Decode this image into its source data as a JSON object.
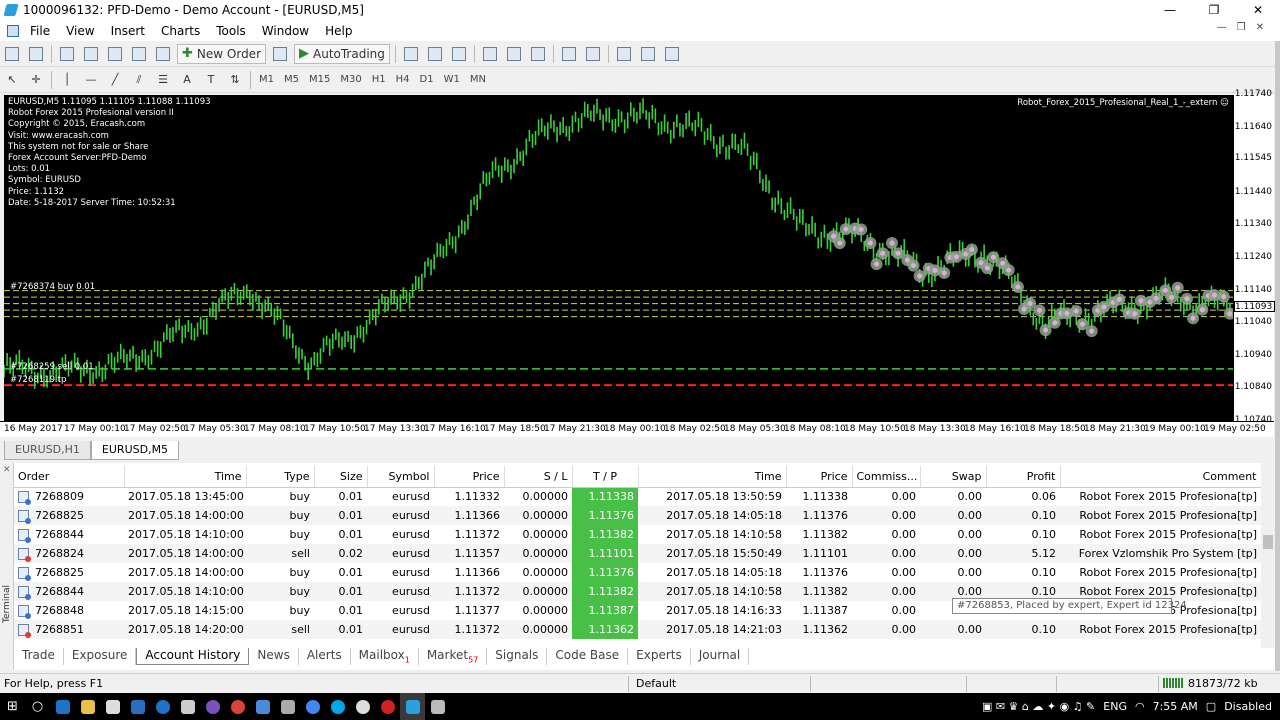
{
  "window": {
    "title": "1000096132: PFD-Demo - Demo Account - [EURUSD,M5]",
    "controls": [
      "—",
      "❐",
      "✕"
    ]
  },
  "menu": [
    "File",
    "View",
    "Insert",
    "Charts",
    "Tools",
    "Window",
    "Help"
  ],
  "toolbar": {
    "new_order": "New Order",
    "auto_trading": "AutoTrading"
  },
  "timeframes": [
    "M1",
    "M5",
    "M15",
    "M30",
    "H1",
    "H4",
    "D1",
    "W1",
    "MN"
  ],
  "chart": {
    "symbol_line": "EURUSD,M5  1.11095 1.11105 1.11088 1.11093",
    "ea_name": "Robot_Forex_2015_Profesional_Real_1_-_extern",
    "info_lines": [
      "Robot Forex 2015 Profesional version II",
      "Copyright © 2015, Eracash.com",
      "Visit: www.eracash.com",
      "This system not for sale or Share",
      "Forex Account Server:PFD-Demo",
      "Lots:  0.01",
      "Symbol: EURUSD",
      "Price:  1.1132",
      "Date: 5-18-2017 Server Time: 10:52:31"
    ],
    "order_labels": [
      "#7268374 buy 0.01",
      "#7268259 sell 0.01",
      "#7268119 tp"
    ],
    "price_labels": [
      "1.11740",
      "1.11640",
      "1.11545",
      "1.11440",
      "1.11340",
      "1.11240",
      "1.11140",
      "1.11040",
      "1.10940",
      "1.10840",
      "1.10740"
    ],
    "current_price": "1.11093",
    "time_labels": [
      "16 May 2017",
      "17 May 00:10",
      "17 May 02:50",
      "17 May 05:30",
      "17 May 08:10",
      "17 May 10:50",
      "17 May 13:30",
      "17 May 16:10",
      "17 May 18:50",
      "17 May 21:30",
      "18 May 00:10",
      "18 May 02:50",
      "18 May 05:30",
      "18 May 08:10",
      "18 May 10:50",
      "18 May 13:30",
      "18 May 16:10",
      "18 May 18:50",
      "18 May 21:30",
      "19 May 00:10",
      "19 May 02:50"
    ],
    "tabs": [
      "EURUSD,H1",
      "EURUSD,M5"
    ],
    "colors": {
      "candle": "#3ccf3c",
      "marker": "#e7a6e0",
      "sl_line": "#ff2020"
    }
  },
  "chart_data": {
    "type": "line",
    "title": "",
    "xlabel": "",
    "ylabel": "",
    "ylim": [
      1.1074,
      1.1174
    ],
    "x": [
      "16 May 2017",
      "17 May 00:10",
      "17 May 02:50",
      "17 May 05:30",
      "17 May 08:10",
      "17 May 10:50",
      "17 May 13:30",
      "17 May 16:10",
      "17 May 18:50",
      "17 May 21:30",
      "18 May 00:10",
      "18 May 02:50",
      "18 May 05:30",
      "18 May 08:10",
      "18 May 10:50",
      "18 May 13:30",
      "18 May 16:10",
      "18 May 18:50",
      "18 May 21:30",
      "19 May 00:10",
      "19 May 02:50"
    ],
    "series": [
      {
        "name": "EURUSD,M5",
        "values": [
          1.109,
          1.1089,
          1.1092,
          1.1102,
          1.1115,
          1.1092,
          1.1105,
          1.1121,
          1.115,
          1.1165,
          1.1168,
          1.1165,
          1.1158,
          1.1133,
          1.113,
          1.112,
          1.1126,
          1.1104,
          1.1108,
          1.1112,
          1.1109
        ]
      }
    ],
    "grid": false,
    "legend": "none"
  },
  "terminal": {
    "side_label": "Terminal",
    "columns": [
      "Order",
      "Time",
      "Type",
      "Size",
      "Symbol",
      "Price",
      "S / L",
      "T / P",
      "Time",
      "Price",
      "Commiss...",
      "Swap",
      "Profit",
      "Comment"
    ],
    "rows": [
      [
        "7268809",
        "2017.05.18 13:45:00",
        "buy",
        "0.01",
        "eurusd",
        "1.11332",
        "0.00000",
        "1.11338",
        "2017.05.18 13:50:59",
        "1.11338",
        "0.00",
        "0.00",
        "0.06",
        "Robot Forex 2015 Profesiona[tp]"
      ],
      [
        "7268825",
        "2017.05.18 14:00:00",
        "buy",
        "0.01",
        "eurusd",
        "1.11366",
        "0.00000",
        "1.11376",
        "2017.05.18 14:05:18",
        "1.11376",
        "0.00",
        "0.00",
        "0.10",
        "Robot Forex 2015 Profesiona[tp]"
      ],
      [
        "7268844",
        "2017.05.18 14:10:00",
        "buy",
        "0.01",
        "eurusd",
        "1.11372",
        "0.00000",
        "1.11382",
        "2017.05.18 14:10:58",
        "1.11382",
        "0.00",
        "0.00",
        "0.10",
        "Robot Forex 2015 Profesiona[tp]"
      ],
      [
        "7268824",
        "2017.05.18 14:00:00",
        "sell",
        "0.02",
        "eurusd",
        "1.11357",
        "0.00000",
        "1.11101",
        "2017.05.18 15:50:49",
        "1.11101",
        "0.00",
        "0.00",
        "5.12",
        "Forex Vzlomshik Pro System [tp]"
      ],
      [
        "7268825",
        "2017.05.18 14:00:00",
        "buy",
        "0.01",
        "eurusd",
        "1.11366",
        "0.00000",
        "1.11376",
        "2017.05.18 14:05:18",
        "1.11376",
        "0.00",
        "0.00",
        "0.10",
        "Robot Forex 2015 Profesiona[tp]"
      ],
      [
        "7268844",
        "2017.05.18 14:10:00",
        "buy",
        "0.01",
        "eurusd",
        "1.11372",
        "0.00000",
        "1.11382",
        "2017.05.18 14:10:58",
        "1.11382",
        "0.00",
        "0.00",
        "0.10",
        "Robot Forex 2015 Profesiona[tp]"
      ],
      [
        "7268848",
        "2017.05.18 14:15:00",
        "buy",
        "0.01",
        "eurusd",
        "1.11377",
        "0.00000",
        "1.11387",
        "2017.05.18 14:16:33",
        "1.11387",
        "0.00",
        "0.00",
        "0.10",
        "Robot Forex 2015 Profesiona[tp]"
      ],
      [
        "7268851",
        "2017.05.18 14:20:00",
        "sell",
        "0.01",
        "eurusd",
        "1.11372",
        "0.00000",
        "1.11362",
        "2017.05.18 14:21:03",
        "1.11362",
        "0.00",
        "0.00",
        "0.10",
        "Robot Forex 2015 Profesiona[tp]"
      ]
    ],
    "tooltip": "#7268853, Placed by expert, Expert id 12324",
    "tabs": [
      {
        "label": "Trade",
        "badge": ""
      },
      {
        "label": "Exposure",
        "badge": ""
      },
      {
        "label": "Account History",
        "badge": ""
      },
      {
        "label": "News",
        "badge": ""
      },
      {
        "label": "Alerts",
        "badge": ""
      },
      {
        "label": "Mailbox",
        "badge": "1"
      },
      {
        "label": "Market",
        "badge": "57"
      },
      {
        "label": "Signals",
        "badge": ""
      },
      {
        "label": "Code Base",
        "badge": ""
      },
      {
        "label": "Experts",
        "badge": ""
      },
      {
        "label": "Journal",
        "badge": ""
      }
    ]
  },
  "status": {
    "help": "For Help, press F1",
    "profile": "Default",
    "traffic": "81873/72 kb"
  },
  "taskbar": {
    "lang": "ENG",
    "time": "7:55 AM",
    "extra": "Disabled"
  }
}
